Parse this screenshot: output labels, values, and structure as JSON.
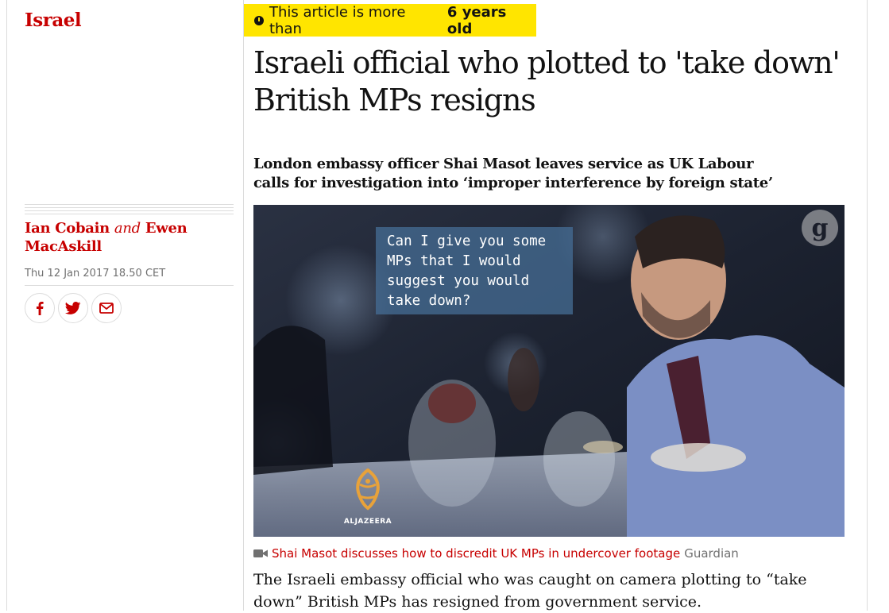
{
  "section": {
    "label": "Israel"
  },
  "age_badge": {
    "prefix": "This article is more than",
    "age": "6 years old",
    "icon": "clock-icon"
  },
  "headline": "Israeli official who plotted to 'take down' British MPs resigns",
  "standfirst": "London embassy officer Shai Masot leaves service as UK Labour calls for investigation into ‘improper interference by foreign state’",
  "byline": {
    "author1": "Ian Cobain",
    "conjunction": "and",
    "author2": "Ewen MacAskill"
  },
  "dateline": "Thu 12 Jan 2017 18.50 CET",
  "share": [
    {
      "name": "facebook",
      "icon": "facebook-icon"
    },
    {
      "name": "twitter",
      "icon": "twitter-icon"
    },
    {
      "name": "email",
      "icon": "email-icon"
    }
  ],
  "video": {
    "subtitle_lines": [
      "Can I give you some",
      "MPs that I would",
      "suggest you would",
      "take down?"
    ],
    "watermark_text": "g",
    "broadcaster_logo": "ALJAZEERA"
  },
  "caption": {
    "icon": "video-camera-icon",
    "text": "Shai Masot discusses how to discredit UK MPs in undercover footage",
    "credit": "Guardian"
  },
  "body": "The Israeli embassy official who was caught on camera plotting to “take down” British MPs has resigned from government service.",
  "colors": {
    "brand_red": "#c70000",
    "badge_yellow": "#ffe500",
    "text": "#121212",
    "muted": "#707070"
  }
}
